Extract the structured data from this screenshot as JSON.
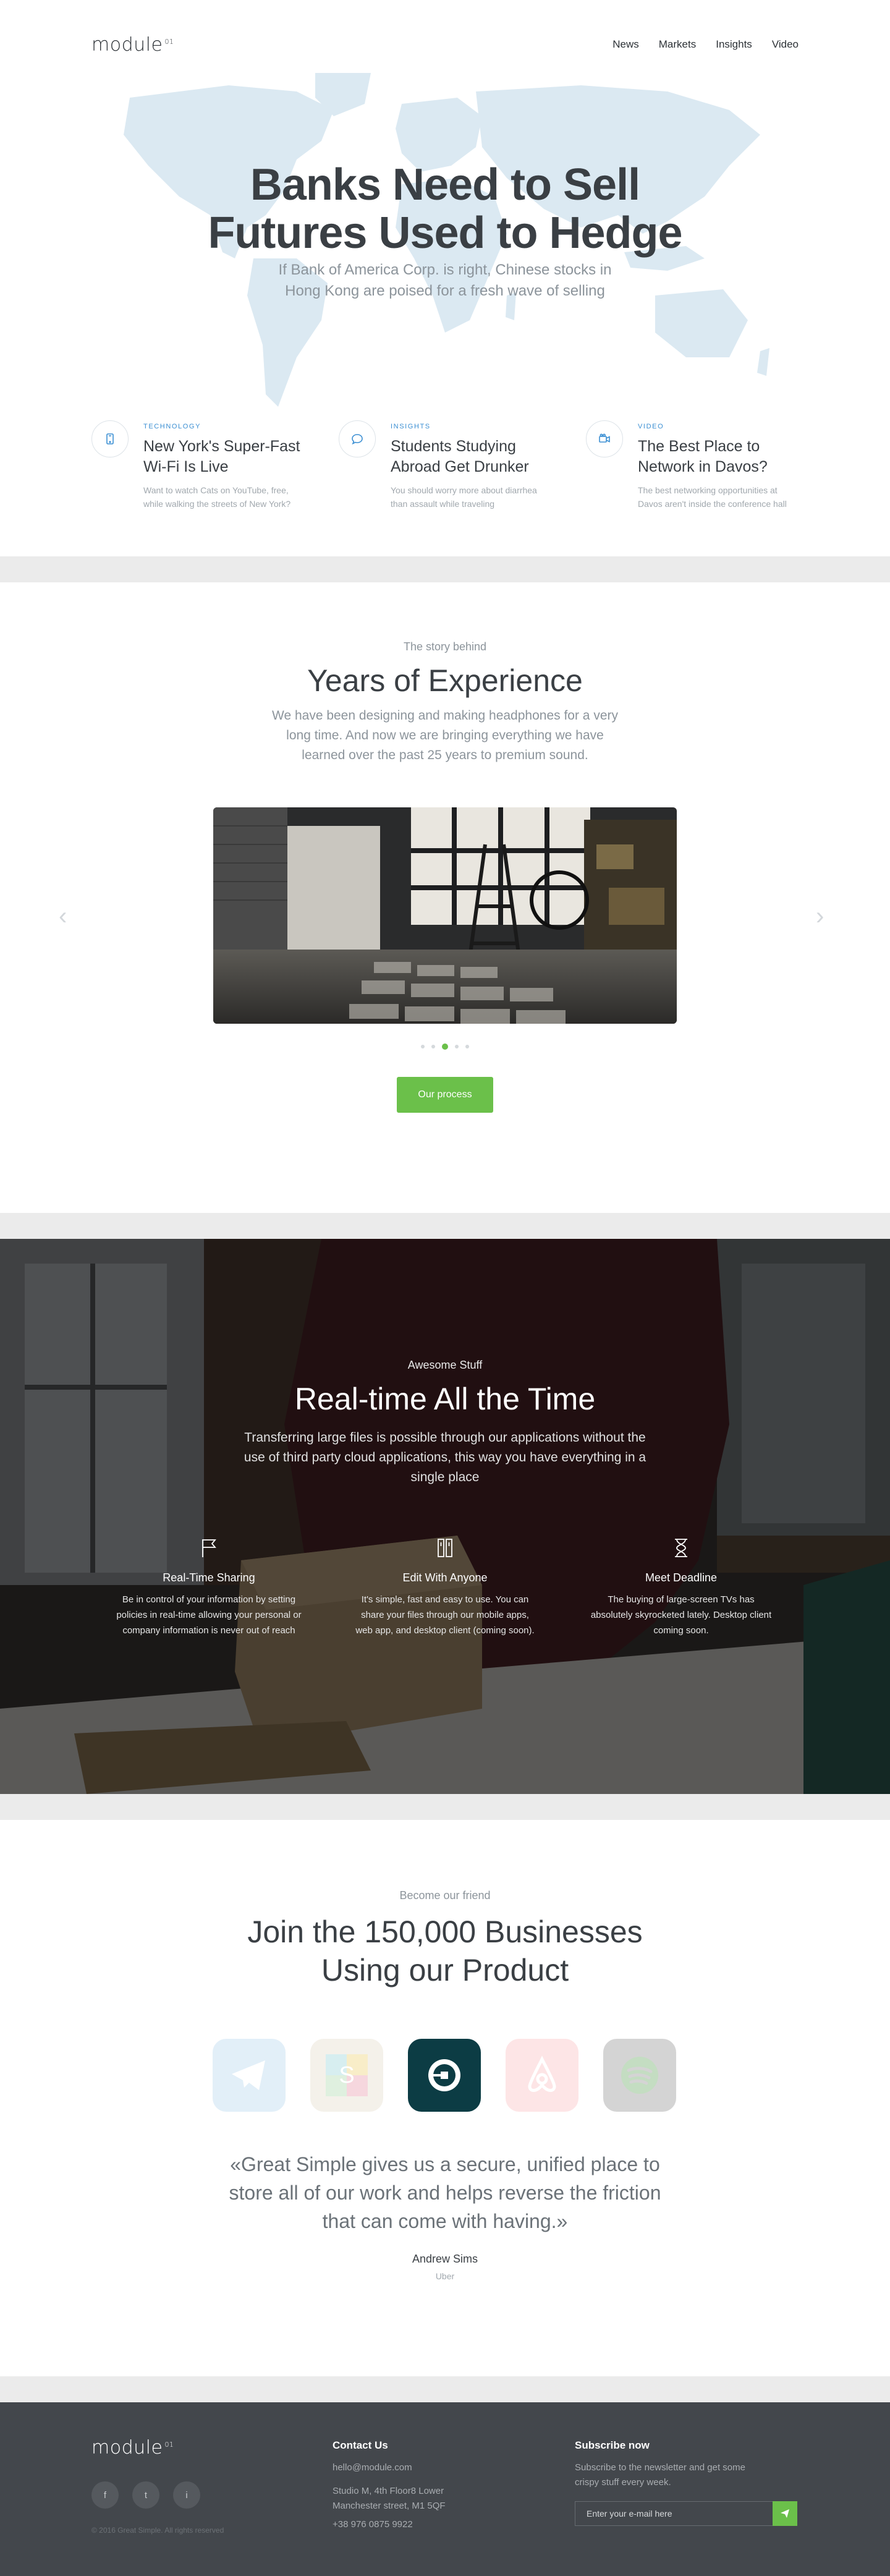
{
  "header": {
    "logo": "module",
    "logo_sup": "01",
    "nav": [
      "News",
      "Markets",
      "Insights",
      "Video"
    ]
  },
  "hero": {
    "title_line1": "Banks Need to Sell",
    "title_line2": "Futures Used to Hedge",
    "subtitle": "If Bank of America Corp. is right, Chinese stocks in Hong Kong are poised for a fresh wave of selling"
  },
  "news": [
    {
      "tag": "Technology",
      "icon": "phone-icon",
      "title": "New York's Super-Fast Wi-Fi Is Live",
      "desc": "Want to watch Cats on YouTube, free, while walking the streets of New York?"
    },
    {
      "tag": "Insights",
      "icon": "chat-bubble-icon",
      "title": "Students Studying Abroad Get Drunker",
      "desc": "You should worry more about diarrhea than assault while traveling"
    },
    {
      "tag": "Video",
      "icon": "video-camera-icon",
      "title": "The Best Place to Network in Davos?",
      "desc": "The best networking opportunities at Davos aren't inside the conference hall"
    }
  ],
  "story": {
    "eyebrow": "The story behind",
    "title": "Years of Experience",
    "text": "We have been designing and making headphones for a very long time. And now we are bringing everything we have learned over the past 25 years to premium sound.",
    "slides_count": 5,
    "active_slide": 2,
    "button": "Our process",
    "arrow_left": "‹",
    "arrow_right": "›"
  },
  "features": {
    "eyebrow": "Awesome Stuff",
    "title": "Real-time All the Time",
    "text": "Transferring large files is possible through our applications without the use of third party cloud applications, this way you have everything in a single place",
    "items": [
      {
        "icon": "flag-icon",
        "title": "Real-Time Sharing",
        "desc": "Be in control of your information by setting policies in real-time allowing your personal or company information is never out of reach"
      },
      {
        "icon": "columns-icon",
        "title": "Edit With Anyone",
        "desc": "It's simple, fast and easy to use. You can share your files through our mobile apps, web app, and desktop client (coming soon)."
      },
      {
        "icon": "hourglass-icon",
        "title": "Meet Deadline",
        "desc": "The buying of large-screen TVs has absolutely skyrocketed lately. Desktop client coming soon."
      }
    ]
  },
  "customers": {
    "eyebrow": "Become our friend",
    "title_line1": "Join the 150,000 Businesses",
    "title_line2": "Using our Product",
    "logos": [
      "telegram-logo",
      "slack-logo",
      "uber-logo",
      "airbnb-logo",
      "spotify-logo"
    ],
    "quote": "«Great Simple gives us a secure, unified place to store all of our work and helps reverse the friction that can come with having.»",
    "author": "Andrew Sims",
    "company": "Uber"
  },
  "footer": {
    "logo": "module",
    "logo_sup": "01",
    "copyright": "© 2016 Great Simple. All rights reserved",
    "contact_title": "Contact Us",
    "email": "hello@module.com",
    "address_line1": "Studio M, 4th Floor8 Lower",
    "address_line2": "Manchester street, M1 5QF",
    "phone": "+38 976 0875 9922",
    "subscribe_title": "Subscribe now",
    "subscribe_text": "Subscribe to the newsletter and get some crispy stuff every week.",
    "subscribe_placeholder": "Enter your e-mail here",
    "social": [
      "f",
      "t",
      "i"
    ]
  },
  "colors": {
    "accent_green": "#6bc04a",
    "link_blue": "#3b8fd3",
    "text_dark": "#3a3f44",
    "footer_bg": "#43474c"
  }
}
